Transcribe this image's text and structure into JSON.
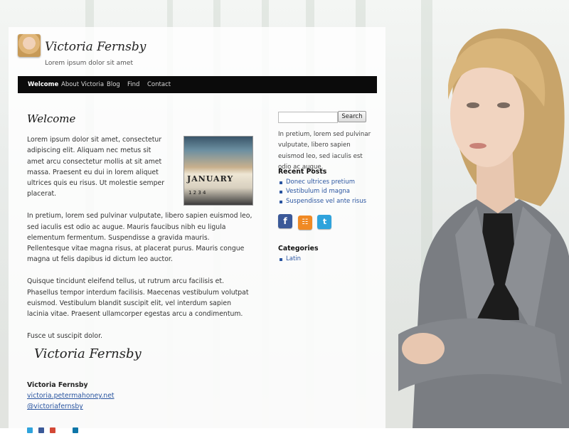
{
  "site": {
    "title": "Victoria Fernsby",
    "description": "Lorem ipsum dolor sit amet"
  },
  "nav": {
    "items": [
      {
        "label": "Welcome",
        "active": true
      },
      {
        "label": "About Victoria",
        "active": false
      },
      {
        "label": "Blog",
        "active": false
      },
      {
        "label": "Find",
        "active": false
      },
      {
        "label": "Contact",
        "active": false
      }
    ]
  },
  "post": {
    "title": "Welcome",
    "paragraphs": [
      "Lorem ipsum dolor sit amet, consectetur adipiscing elit. Aliquam nec metus sit amet arcu consectetur mollis at sit amet massa. Praesent eu dui in lorem aliquet ultrices quis eu risus. Ut molestie semper placerat.",
      "In pretium, lorem sed pulvinar vulputate, libero sapien euismod leo, sed iaculis est odio ac augue. Mauris faucibus nibh eu ligula elementum fermentum. Suspendisse a gravida mauris. Pellentesque vitae magna risus, at placerat purus. Mauris congue magna ut felis dapibus id dictum leo auctor.",
      "Quisque tincidunt eleifend tellus, ut rutrum arcu facilisis et. Phasellus tempor interdum facilisis. Maecenas vestibulum volutpat euismod. Vestibulum blandit suscipit elit, vel interdum sapien lacinia vitae. Praesent ullamcorper egestas arcu a condimentum.",
      "Fusce ut suscipit dolor."
    ],
    "image_text": {
      "month": "JANUARY",
      "days": "1   2   3   4"
    },
    "signature": "Victoria Fernsby"
  },
  "author": {
    "name": "Victoria Fernsby",
    "website": "victoria.petermahoney.net",
    "twitter": "@victoriafernsby"
  },
  "sidebar": {
    "search": {
      "placeholder": "",
      "button_label": "Search"
    },
    "text": "In pretium, lorem sed pulvinar vulputate, libero sapien euismod leo, sed iaculis est odio ac augue.",
    "recent_posts": {
      "title": "Recent Posts",
      "items": [
        "Donec ultrices pretium",
        "Vestibulum id magna",
        "Suspendisse vel ante risus"
      ]
    },
    "social_icons": [
      "facebook-icon",
      "rss-icon",
      "twitter-icon"
    ],
    "categories": {
      "title": "Categories",
      "items": [
        "Latin"
      ]
    }
  },
  "colors": {
    "nav_bg": "#0b0b0b",
    "link": "#2a55a0",
    "facebook": "#3b5998",
    "rss": "#f08a24",
    "twitter": "#2fa3dc"
  }
}
